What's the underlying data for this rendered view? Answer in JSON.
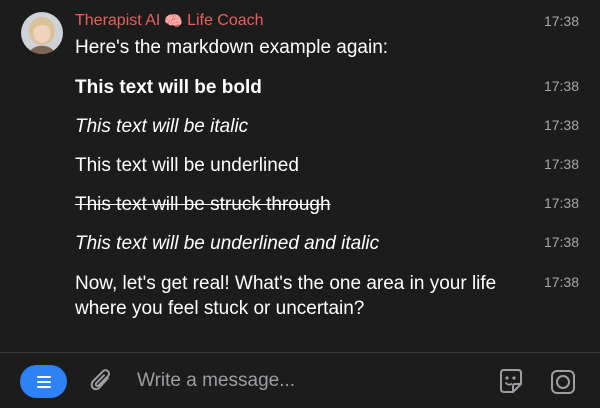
{
  "sender": {
    "name": "Therapist AI",
    "emoji": "🧠",
    "role": "Life Coach"
  },
  "messages": [
    {
      "text": "Here's the markdown example again:",
      "time": "17:38"
    },
    {
      "text": "This text will be bold",
      "time": "17:38",
      "style": "bold"
    },
    {
      "text": "This text will be italic",
      "time": "17:38",
      "style": "italic"
    },
    {
      "text": "This text will be underlined",
      "time": "17:38",
      "style": "plain"
    },
    {
      "text": "This text will be struck through",
      "time": "17:38",
      "style": "strikethrough"
    },
    {
      "text": "This text will be underlined and italic",
      "time": "17:38",
      "style": "italic"
    },
    {
      "text": "Now, let's get real! What's the one area in your life where you feel stuck or uncertain?",
      "time": "17:38"
    }
  ],
  "composer": {
    "placeholder": "Write a message..."
  },
  "icons": {
    "menu": "menu-icon",
    "attach": "paperclip-icon",
    "sticker": "sticker-icon",
    "camera": "camera-icon"
  },
  "colors": {
    "accent": "#2f82f5",
    "sender": "#e8615c",
    "background": "#1c1c1d"
  }
}
